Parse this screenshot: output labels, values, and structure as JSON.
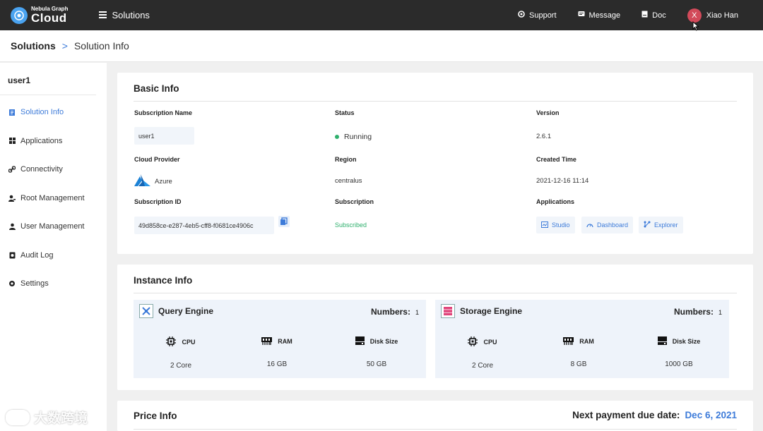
{
  "header": {
    "logo_sub": "Nebula Graph",
    "logo_main": "Cloud",
    "nav_solutions": "Solutions",
    "support": "Support",
    "message": "Message",
    "doc": "Doc",
    "avatar_initial": "X",
    "user_name": "Xiao Han"
  },
  "breadcrumb": {
    "root": "Solutions",
    "separator": ">",
    "current": "Solution Info"
  },
  "sidebar": {
    "user": "user1",
    "items": [
      {
        "label": "Solution Info",
        "icon": "document-icon",
        "active": true
      },
      {
        "label": "Applications",
        "icon": "grid-icon",
        "active": false
      },
      {
        "label": "Connectivity",
        "icon": "link-icon",
        "active": false
      },
      {
        "label": "Root Management",
        "icon": "user-key-icon",
        "active": false
      },
      {
        "label": "User Management",
        "icon": "user-icon",
        "active": false
      },
      {
        "label": "Audit Log",
        "icon": "log-icon",
        "active": false
      },
      {
        "label": "Settings",
        "icon": "gear-icon",
        "active": false
      }
    ]
  },
  "basic_info": {
    "title": "Basic Info",
    "subscription_name_label": "Subscription Name",
    "subscription_name": "user1",
    "status_label": "Status",
    "status": "Running",
    "version_label": "Version",
    "version": "2.6.1",
    "cloud_provider_label": "Cloud Provider",
    "cloud_provider": "Azure",
    "region_label": "Region",
    "region": "centralus",
    "created_time_label": "Created Time",
    "created_time": "2021-12-16 11:14",
    "subscription_id_label": "Subscription ID",
    "subscription_id": "49d858ce-e287-4eb5-cff8-f0681ce4906c",
    "subscription_label": "Subscription",
    "subscription": "Subscribed",
    "applications_label": "Applications",
    "apps": [
      "Studio",
      "Dashboard",
      "Explorer"
    ]
  },
  "instance_info": {
    "title": "Instance Info",
    "query": {
      "name": "Query Engine",
      "numbers_label": "Numbers:",
      "numbers": "1",
      "cpu_label": "CPU",
      "cpu": "2 Core",
      "ram_label": "RAM",
      "ram": "16 GB",
      "disk_label": "Disk Size",
      "disk": "50 GB"
    },
    "storage": {
      "name": "Storage Engine",
      "numbers_label": "Numbers:",
      "numbers": "1",
      "cpu_label": "CPU",
      "cpu": "2 Core",
      "ram_label": "RAM",
      "ram": "8 GB",
      "disk_label": "Disk Size",
      "disk": "1000 GB"
    }
  },
  "price_info": {
    "title": "Price Info",
    "due_label": "Next payment due date:",
    "due_date": "Dec 6, 2021"
  },
  "watermark": {
    "text": "大数跨境"
  },
  "colors": {
    "accent": "#3d7bd9",
    "topbar": "#2b2b2b",
    "running": "#2fb06d",
    "avatar": "#d24a5a"
  }
}
